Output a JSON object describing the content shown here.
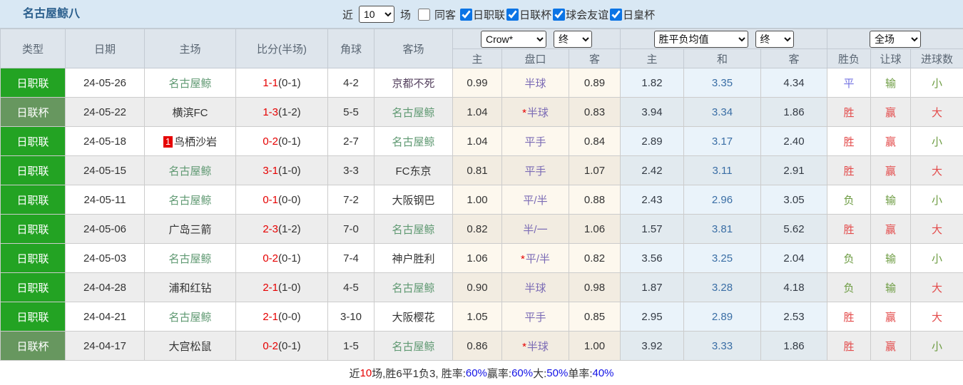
{
  "toolbar": {
    "title": "名古屋鲸八",
    "recent_label": "近",
    "recent_value": "10",
    "games_label": "场",
    "same_away": {
      "label": "同客",
      "checked": false
    },
    "filters": [
      {
        "label": "日职联",
        "checked": true
      },
      {
        "label": "日联杯",
        "checked": true
      },
      {
        "label": "球会友谊",
        "checked": true
      },
      {
        "label": "日皇杯",
        "checked": true
      }
    ]
  },
  "header": {
    "type": "类型",
    "date": "日期",
    "home": "主场",
    "score": "比分(半场)",
    "corners": "角球",
    "away": "客场",
    "odds_source_select": "Crow*",
    "odds_time_select": "终",
    "avg_select": "胜平负均值",
    "avg_time_select": "终",
    "scope_select": "全场",
    "sub": {
      "home_odds": "主",
      "handicap": "盘口",
      "away_odds": "客",
      "avg_home": "主",
      "avg_draw": "和",
      "avg_away": "客",
      "result": "胜负",
      "handicap_result": "让球",
      "goals": "进球数"
    }
  },
  "colors": {
    "league_green": "#23a323",
    "cup_green": "#67975f",
    "team_green": "#5f9972",
    "score_red": "#e60000",
    "handicap_purple": "#7b6bb5",
    "avg_draw_blue": "#3a6ea5",
    "result_win_red": "#e34b4b",
    "result_lose_green": "#6d9c42",
    "result_draw_blue": "#7473e2",
    "summary_blue": "#1212e6",
    "toolbar_bg": "#d9e8f4",
    "header_bg": "#dee5ec",
    "crow_bg": "#fdf8ee",
    "avg_bg": "#eaf3fa"
  },
  "rows": [
    {
      "league": "日职联",
      "cup": false,
      "date": "24-05-26",
      "badge": "",
      "home": "名古屋鲸",
      "homeGreen": true,
      "score": "1-1",
      "half": "(0-1)",
      "corners": "4-2",
      "away": "京都不死",
      "awayGreen": false,
      "awayPurple": true,
      "oddsHome": "0.99",
      "star": false,
      "handicap": "半球",
      "oddsAway": "0.89",
      "avgHome": "1.82",
      "avgDraw": "3.35",
      "avgAway": "4.34",
      "resWdl": "平",
      "resWdlC": "draw",
      "resLet": "输",
      "resLetC": "lose",
      "resGoal": "小",
      "resGoalC": "lose"
    },
    {
      "league": "日联杯",
      "cup": true,
      "date": "24-05-22",
      "badge": "",
      "home": "横滨FC",
      "homeGreen": false,
      "score": "1-3",
      "half": "(1-2)",
      "corners": "5-5",
      "away": "名古屋鲸",
      "awayGreen": true,
      "awayPurple": false,
      "oddsHome": "1.04",
      "star": true,
      "handicap": "半球",
      "oddsAway": "0.83",
      "avgHome": "3.94",
      "avgDraw": "3.34",
      "avgAway": "1.86",
      "resWdl": "胜",
      "resWdlC": "win",
      "resLet": "赢",
      "resLetC": "win",
      "resGoal": "大",
      "resGoalC": "win"
    },
    {
      "league": "日职联",
      "cup": false,
      "date": "24-05-18",
      "badge": "1",
      "home": "鸟栖沙岩",
      "homeGreen": false,
      "score": "0-2",
      "half": "(0-1)",
      "corners": "2-7",
      "away": "名古屋鲸",
      "awayGreen": true,
      "awayPurple": false,
      "oddsHome": "1.04",
      "star": false,
      "handicap": "平手",
      "oddsAway": "0.84",
      "avgHome": "2.89",
      "avgDraw": "3.17",
      "avgAway": "2.40",
      "resWdl": "胜",
      "resWdlC": "win",
      "resLet": "赢",
      "resLetC": "win",
      "resGoal": "小",
      "resGoalC": "lose"
    },
    {
      "league": "日职联",
      "cup": false,
      "date": "24-05-15",
      "badge": "",
      "home": "名古屋鲸",
      "homeGreen": true,
      "score": "3-1",
      "half": "(1-0)",
      "corners": "3-3",
      "away": "FC东京",
      "awayGreen": false,
      "awayPurple": false,
      "oddsHome": "0.81",
      "star": false,
      "handicap": "平手",
      "oddsAway": "1.07",
      "avgHome": "2.42",
      "avgDraw": "3.11",
      "avgAway": "2.91",
      "resWdl": "胜",
      "resWdlC": "win",
      "resLet": "赢",
      "resLetC": "win",
      "resGoal": "大",
      "resGoalC": "win"
    },
    {
      "league": "日职联",
      "cup": false,
      "date": "24-05-11",
      "badge": "",
      "home": "名古屋鲸",
      "homeGreen": true,
      "score": "0-1",
      "half": "(0-0)",
      "corners": "7-2",
      "away": "大阪钢巴",
      "awayGreen": false,
      "awayPurple": false,
      "oddsHome": "1.00",
      "star": false,
      "handicap": "平/半",
      "oddsAway": "0.88",
      "avgHome": "2.43",
      "avgDraw": "2.96",
      "avgAway": "3.05",
      "resWdl": "负",
      "resWdlC": "lose",
      "resLet": "输",
      "resLetC": "lose",
      "resGoal": "小",
      "resGoalC": "lose"
    },
    {
      "league": "日职联",
      "cup": false,
      "date": "24-05-06",
      "badge": "",
      "home": "广岛三箭",
      "homeGreen": false,
      "score": "2-3",
      "half": "(1-2)",
      "corners": "7-0",
      "away": "名古屋鲸",
      "awayGreen": true,
      "awayPurple": false,
      "oddsHome": "0.82",
      "star": false,
      "handicap": "半/一",
      "oddsAway": "1.06",
      "avgHome": "1.57",
      "avgDraw": "3.81",
      "avgAway": "5.62",
      "resWdl": "胜",
      "resWdlC": "win",
      "resLet": "赢",
      "resLetC": "win",
      "resGoal": "大",
      "resGoalC": "win"
    },
    {
      "league": "日职联",
      "cup": false,
      "date": "24-05-03",
      "badge": "",
      "home": "名古屋鲸",
      "homeGreen": true,
      "score": "0-2",
      "half": "(0-1)",
      "corners": "7-4",
      "away": "神户胜利",
      "awayGreen": false,
      "awayPurple": false,
      "oddsHome": "1.06",
      "star": true,
      "handicap": "平/半",
      "oddsAway": "0.82",
      "avgHome": "3.56",
      "avgDraw": "3.25",
      "avgAway": "2.04",
      "resWdl": "负",
      "resWdlC": "lose",
      "resLet": "输",
      "resLetC": "lose",
      "resGoal": "小",
      "resGoalC": "lose"
    },
    {
      "league": "日职联",
      "cup": false,
      "date": "24-04-28",
      "badge": "",
      "home": "浦和红钻",
      "homeGreen": false,
      "score": "2-1",
      "half": "(1-0)",
      "corners": "4-5",
      "away": "名古屋鲸",
      "awayGreen": true,
      "awayPurple": false,
      "oddsHome": "0.90",
      "star": false,
      "handicap": "半球",
      "oddsAway": "0.98",
      "avgHome": "1.87",
      "avgDraw": "3.28",
      "avgAway": "4.18",
      "resWdl": "负",
      "resWdlC": "lose",
      "resLet": "输",
      "resLetC": "lose",
      "resGoal": "大",
      "resGoalC": "win"
    },
    {
      "league": "日职联",
      "cup": false,
      "date": "24-04-21",
      "badge": "",
      "home": "名古屋鲸",
      "homeGreen": true,
      "score": "2-1",
      "half": "(0-0)",
      "corners": "3-10",
      "away": "大阪樱花",
      "awayGreen": false,
      "awayPurple": false,
      "oddsHome": "1.05",
      "star": false,
      "handicap": "平手",
      "oddsAway": "0.85",
      "avgHome": "2.95",
      "avgDraw": "2.89",
      "avgAway": "2.53",
      "resWdl": "胜",
      "resWdlC": "win",
      "resLet": "赢",
      "resLetC": "win",
      "resGoal": "大",
      "resGoalC": "win"
    },
    {
      "league": "日联杯",
      "cup": true,
      "date": "24-04-17",
      "badge": "",
      "home": "大宫松鼠",
      "homeGreen": false,
      "score": "0-2",
      "half": "(0-1)",
      "corners": "1-5",
      "away": "名古屋鲸",
      "awayGreen": true,
      "awayPurple": false,
      "oddsHome": "0.86",
      "star": true,
      "handicap": "半球",
      "oddsAway": "1.00",
      "avgHome": "3.92",
      "avgDraw": "3.33",
      "avgAway": "1.86",
      "resWdl": "胜",
      "resWdlC": "win",
      "resLet": "赢",
      "resLetC": "win",
      "resGoal": "小",
      "resGoalC": "lose"
    }
  ],
  "summary": [
    {
      "t": "近",
      "c": "dark"
    },
    {
      "t": "10",
      "c": "red"
    },
    {
      "t": "场,胜6平1负3, 胜率:",
      "c": "dark"
    },
    {
      "t": "60%",
      "c": "blue"
    },
    {
      "t": " 赢率:",
      "c": "dark"
    },
    {
      "t": "60%",
      "c": "blue"
    },
    {
      "t": " 大:",
      "c": "dark"
    },
    {
      "t": "50%",
      "c": "blue"
    },
    {
      "t": " 单率:",
      "c": "dark"
    },
    {
      "t": "40%",
      "c": "blue"
    }
  ]
}
